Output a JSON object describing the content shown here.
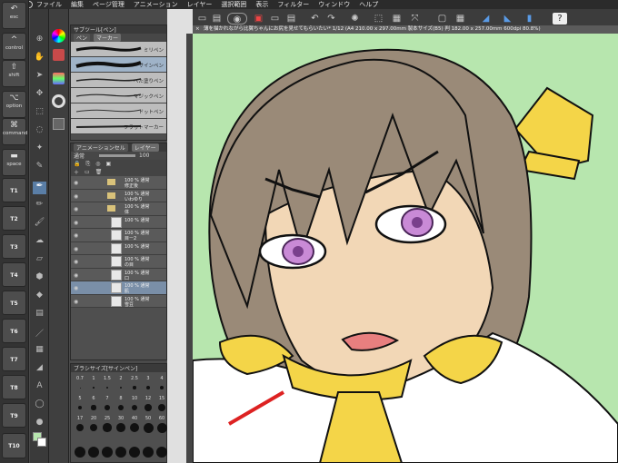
{
  "menubar": {
    "items": [
      "ファイル",
      "編集",
      "ページ管理",
      "アニメーション",
      "レイヤー",
      "選択範囲",
      "表示",
      "フィルター",
      "ウィンドウ",
      "ヘルプ"
    ]
  },
  "sidebar": {
    "keys": [
      {
        "label": "esc",
        "icon": "undo-icon"
      },
      {
        "label": "control",
        "icon": "control-icon"
      },
      {
        "label": "shift",
        "icon": "shift-icon"
      },
      {
        "label": "option",
        "icon": "option-icon"
      },
      {
        "label": "command",
        "icon": "command-icon"
      },
      {
        "label": "space",
        "icon": "space-icon"
      }
    ],
    "tkeys": [
      "T1",
      "T2",
      "T3",
      "T4",
      "T5",
      "T6",
      "T7",
      "T8",
      "T9",
      "T10"
    ]
  },
  "subtool_panel": {
    "title": "サブツール[ペン]",
    "tabs": [
      "ペン",
      "マーカー"
    ],
    "brushes": [
      "ミリペン",
      "サインペン",
      "べた塗りペン",
      "マジックペン",
      "ドットペン",
      "フラットマーカー"
    ]
  },
  "layer_panel": {
    "tab_left": "アニメーションセル",
    "tab_right": "レイヤー",
    "blend_mode": "通常",
    "opacity": "100",
    "layers": [
      {
        "t1": "100 % 通常",
        "t2": "修正後",
        "type": "folder"
      },
      {
        "t1": "100 % 通常",
        "t2": "いわゆり",
        "type": "folder"
      },
      {
        "t1": "100 % 通常",
        "t2": "体",
        "type": "folder"
      },
      {
        "t1": "100 % 通常",
        "t2": "",
        "type": "layer"
      },
      {
        "t1": "100 % 通常",
        "t2": "目ー2",
        "type": "layer"
      },
      {
        "t1": "100 % 通常",
        "t2": "",
        "type": "layer"
      },
      {
        "t1": "100 % 通常",
        "t2": "の目",
        "type": "layer"
      },
      {
        "t1": "100 % 通常",
        "t2": "口",
        "type": "layer"
      },
      {
        "t1": "100 % 通常",
        "t2": "肌",
        "type": "layer",
        "selected": true
      },
      {
        "t1": "100 % 通常",
        "t2": "雪豆",
        "type": "layer"
      }
    ]
  },
  "brush_size_panel": {
    "title": "ブラシサイズ[サインペン]",
    "row1": [
      "0.7",
      "1",
      "1.5",
      "2",
      "2.5",
      "3",
      "4"
    ],
    "row2": [
      "5",
      "6",
      "7",
      "8",
      "10",
      "12",
      "15"
    ],
    "row3": [
      "17",
      "20",
      "25",
      "30",
      "40",
      "50",
      "60"
    ]
  },
  "document": {
    "title": "薄を描かれながら比翼ちゃんにお尻を見せてもらいたい* 1/12 (A4 210.00 x 297.00mm 製本サイズ(B5) 判 182.00 x 257.00mm 600dpi 80.8%)"
  },
  "colors": {
    "canvas_bg": "#b7e6ae",
    "hair": "#9a8a78",
    "skin": "#f2d7b6",
    "eye": "#c98ad6",
    "ribbon": "#f4d548",
    "selection": "#5a7ea6"
  }
}
